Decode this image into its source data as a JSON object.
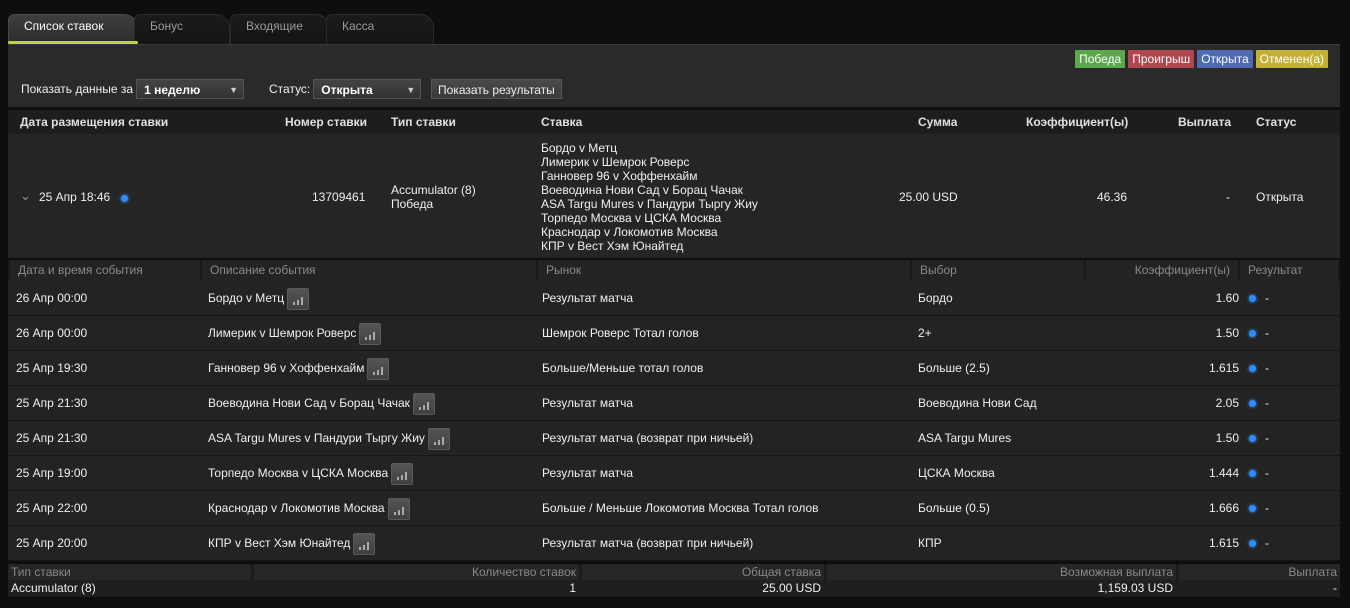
{
  "tabs": [
    {
      "label": "Список ставок",
      "active": true
    },
    {
      "label": "Бонус"
    },
    {
      "label": "Входящие"
    },
    {
      "label": "Касса"
    }
  ],
  "legend": [
    {
      "label": "Победа",
      "color": "#5aa84b"
    },
    {
      "label": "Проигрыш",
      "color": "#b1474e"
    },
    {
      "label": "Открыта",
      "color": "#4f69b4"
    },
    {
      "label": "Отменен(а)",
      "color": "#c3b034"
    }
  ],
  "filters": {
    "period_label": "Показать данные за",
    "period_value": "1 неделю",
    "status_label": "Статус:",
    "status_value": "Открыта",
    "show_button": "Показать результаты"
  },
  "main_headers": {
    "date": "Дата размещения ставки",
    "number": "Номер ставки",
    "type": "Тип ставки",
    "bet": "Ставка",
    "sum": "Сумма",
    "odds": "Коэффициент(ы)",
    "payout": "Выплата",
    "status": "Статус"
  },
  "bet": {
    "date": "25 Апр 18:46",
    "number": "13709461",
    "type": "Accumulator (8)",
    "type_sub": "Победа",
    "events": [
      "Бордо v Метц",
      "Лимерик v Шемрок Роверс",
      "Ганновер 96 v Хоффенхайм",
      "Воеводина Нови Сад v Борац Чачак",
      "ASA Targu Mures v Пандури Тыргу Жиу",
      "Торпедо Москва v ЦСКА Москва",
      "Краснодар v Локомотив Москва",
      "КПР v Вест Хэм Юнайтед"
    ],
    "sum": "25.00 USD",
    "odds": "46.36",
    "payout": "-",
    "status": "Открыта"
  },
  "sub_headers": {
    "date": "Дата и время события",
    "desc": "Описание события",
    "market": "Рынок",
    "pick": "Выбор",
    "odds": "Коэффициент(ы)",
    "result": "Результат"
  },
  "selections": [
    {
      "date": "26 Апр 00:00",
      "event": "Бордо v Метц",
      "market": "Результат матча",
      "pick": "Бордо",
      "odds": "1.60",
      "result": "-"
    },
    {
      "date": "26 Апр 00:00",
      "event": "Лимерик v Шемрок Роверс",
      "market": "Шемрок Роверс Тотал голов",
      "pick": "2+",
      "odds": "1.50",
      "result": "-"
    },
    {
      "date": "25 Апр 19:30",
      "event": "Ганновер 96 v Хоффенхайм",
      "market": "Больше/Меньше тотал голов",
      "pick": "Больше (2.5)",
      "odds": "1.615",
      "result": "-"
    },
    {
      "date": "25 Апр 21:30",
      "event": "Воеводина Нови Сад v Борац Чачак",
      "market": "Результат матча",
      "pick": "Воеводина Нови Сад",
      "odds": "2.05",
      "result": "-"
    },
    {
      "date": "25 Апр 21:30",
      "event": "ASA Targu Mures v Пандури Тыргу Жиу",
      "market": "Результат матча (возврат при ничьей)",
      "pick": "ASA Targu Mures",
      "odds": "1.50",
      "result": "-"
    },
    {
      "date": "25 Апр 19:00",
      "event": "Торпедо Москва v ЦСКА Москва",
      "market": "Результат матча",
      "pick": "ЦСКА Москва",
      "odds": "1.444",
      "result": "-"
    },
    {
      "date": "25 Апр 22:00",
      "event": "Краснодар v Локомотив Москва",
      "market": "Больше / Меньше Локомотив Москва Тотал голов",
      "pick": "Больше (0.5)",
      "odds": "1.666",
      "result": "-"
    },
    {
      "date": "25 Апр 20:00",
      "event": "КПР v Вест Хэм Юнайтед",
      "market": "Результат матча (возврат при ничьей)",
      "pick": "КПР",
      "odds": "1.615",
      "result": "-"
    }
  ],
  "summary_headers": {
    "type": "Тип ставки",
    "count": "Количество ставок",
    "total": "Общая ставка",
    "possible": "Возможная выплата",
    "payout": "Выплата"
  },
  "summary": {
    "type": "Accumulator (8)",
    "count": "1",
    "total": "25.00 USD",
    "possible": "1,159.03 USD",
    "payout": "-"
  },
  "icons": {
    "expand": "chevron-down-icon",
    "status_dot": "status-dot-icon",
    "stats": "stats-bars-icon"
  }
}
